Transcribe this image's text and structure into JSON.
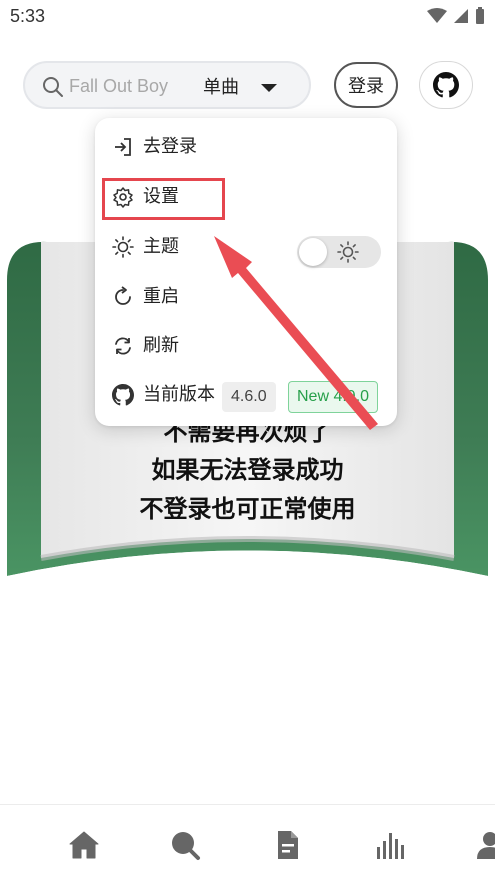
{
  "status_bar": {
    "time": "5:33"
  },
  "search": {
    "placeholder": "Fall Out Boy",
    "type_label": "单曲"
  },
  "header": {
    "login_label": "登录"
  },
  "banner": {
    "line_partial": "不需要再次烦了",
    "line_2": "如果无法登录成功",
    "line_3": "不登录也可正常使用"
  },
  "menu": {
    "items": [
      {
        "label": "去登录",
        "icon": "login-icon"
      },
      {
        "label": "设置",
        "icon": "gear-icon"
      },
      {
        "label": "主题",
        "icon": "sun-icon"
      },
      {
        "label": "重启",
        "icon": "restart-icon"
      },
      {
        "label": "刷新",
        "icon": "refresh-icon"
      },
      {
        "label": "当前版本",
        "icon": "github-icon"
      }
    ],
    "current_version": "4.6.0",
    "new_version": "New 4.9.0"
  },
  "bottom_nav": {
    "items": [
      "home-icon",
      "search-icon",
      "document-icon",
      "chart-bars-icon",
      "user-icon"
    ]
  },
  "colors": {
    "accent_green": "#3d7a52",
    "highlight_red": "#e5464e",
    "new_version_green": "#27a04a"
  }
}
